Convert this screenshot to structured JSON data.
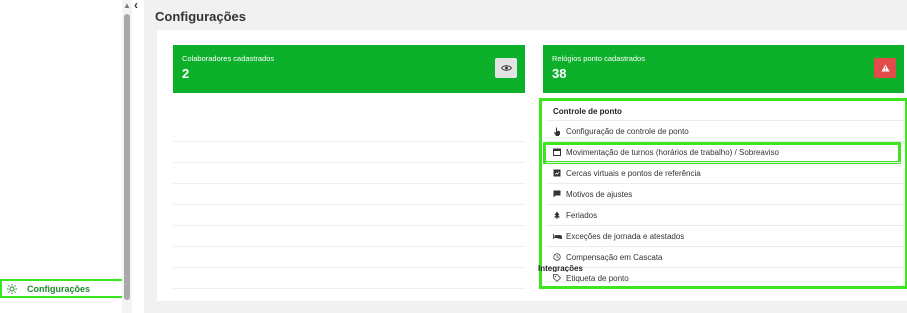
{
  "sidebar": {
    "active_item": {
      "label": "Configurações",
      "icon": "gear-icon"
    },
    "collapse_icon": "chevron-left-icon"
  },
  "page": {
    "title": "Configurações"
  },
  "cards": {
    "colaboradores": {
      "label": "Colaboradores cadastrados",
      "value": "2",
      "icon": "eye-icon"
    },
    "relogios": {
      "label": "Relógios ponto cadastrados",
      "value": "38",
      "icon": "warning-icon"
    }
  },
  "controle_de_ponto": {
    "title": "Controle de ponto",
    "items": [
      {
        "label": "Configuração de controle de ponto",
        "icon": "hand-pointer-icon"
      },
      {
        "label": "Movimentação de turnos (horários de trabalho) / Sobreaviso",
        "icon": "calendar-icon"
      },
      {
        "label": "Cercas virtuais e pontos de referência",
        "icon": "map-icon"
      },
      {
        "label": "Motivos de ajustes",
        "icon": "comment-icon"
      },
      {
        "label": "Feriados",
        "icon": "tree-icon"
      },
      {
        "label": "Exceções de jornada e atestados",
        "icon": "bed-icon"
      },
      {
        "label": "Compensação em Cascata",
        "icon": "clock-icon"
      },
      {
        "label": "Etiqueta de ponto",
        "icon": "tag-icon"
      }
    ]
  },
  "next_section": {
    "title": "Integrações"
  },
  "colors": {
    "brand_green": "#0db02b",
    "highlight": "#3de51f",
    "alert_red": "#e34b4b"
  }
}
